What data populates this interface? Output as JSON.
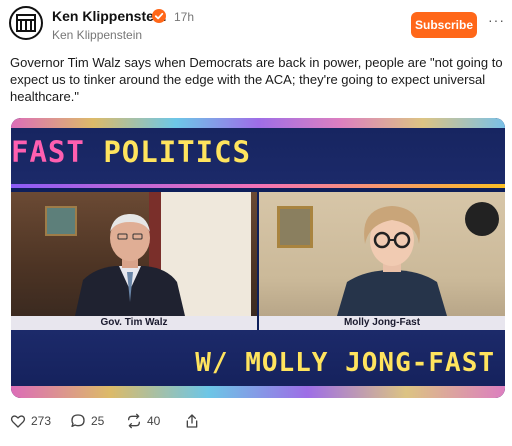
{
  "post": {
    "author": "Ken Klippenstein",
    "publication": "Ken Klippenstein",
    "time": "17h",
    "subscribe_label": "Subscribe",
    "more_label": "···",
    "text": "Governor Tim Walz says when Democrats are back in power, people are \"not going to expect us to tinker around the edge with the ACA; they're going to expect universal healthcare.\""
  },
  "video": {
    "title_part1": "FAST",
    "title_part2": "POLITICS",
    "left_caption": "Gov. Tim Walz",
    "right_caption": "Molly Jong-Fast",
    "subtitle": "W/ MOLLY JONG-FAST"
  },
  "actions": {
    "likes": "273",
    "comments": "25",
    "restacks": "40"
  },
  "icons": {
    "verified": "verified-badge-icon",
    "like": "heart-icon",
    "comment": "comment-icon",
    "restack": "restack-icon",
    "share": "share-icon"
  },
  "colors": {
    "subscribe": "#ff6719",
    "verified": "#ff6719",
    "title_pink": "#ff5fb0",
    "title_yellow": "#ffe45e"
  }
}
